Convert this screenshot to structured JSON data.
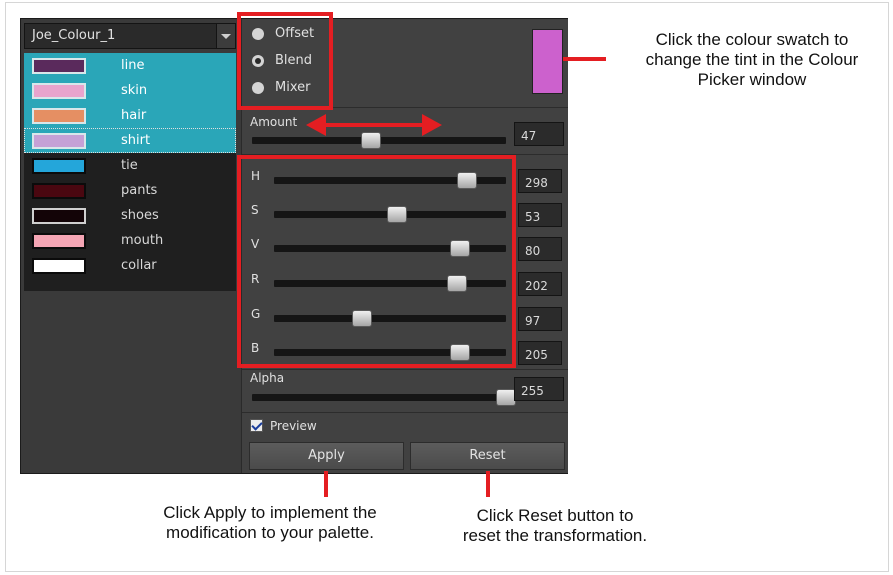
{
  "palette": {
    "name": "Joe_Colour_1",
    "colours": [
      {
        "name": "line",
        "hex": "#5a2a5c",
        "selected": true
      },
      {
        "name": "skin",
        "hex": "#e8a4cd",
        "selected": true
      },
      {
        "name": "hair",
        "hex": "#e58f63",
        "selected": true
      },
      {
        "name": "shirt",
        "hex": "#c5a1d6",
        "selected": true
      },
      {
        "name": "tie",
        "hex": "#24a6da",
        "selected": false
      },
      {
        "name": "pants",
        "hex": "#4a0710",
        "selected": false
      },
      {
        "name": "shoes",
        "hex": "#130407",
        "selected": false
      },
      {
        "name": "mouth",
        "hex": "#f4a5b4",
        "selected": false
      },
      {
        "name": "collar",
        "hex": "#ffffff",
        "selected": false
      }
    ]
  },
  "modes": {
    "offset_label": "Offset",
    "blend_label": "Blend",
    "mixer_label": "Mixer",
    "selected": "Blend"
  },
  "tint_swatch_color": "#cc61cd",
  "amount": {
    "label": "Amount",
    "value": "47",
    "fraction": 0.47
  },
  "sliders": [
    {
      "label": "H",
      "value": "298",
      "fraction": 0.83
    },
    {
      "label": "S",
      "value": "53",
      "fraction": 0.53
    },
    {
      "label": "V",
      "value": "80",
      "fraction": 0.8
    },
    {
      "label": "R",
      "value": "202",
      "fraction": 0.79
    },
    {
      "label": "G",
      "value": "97",
      "fraction": 0.38
    },
    {
      "label": "B",
      "value": "205",
      "fraction": 0.8
    }
  ],
  "alpha": {
    "label": "Alpha",
    "value": "255",
    "fraction": 1.0
  },
  "preview": {
    "label": "Preview",
    "checked": true
  },
  "buttons": {
    "apply": "Apply",
    "reset": "Reset"
  },
  "annotations": {
    "swatch_line1": "Click the colour swatch to",
    "swatch_line2": "change the tint in the Colour",
    "swatch_line3": "Picker window",
    "apply_line1": "Click Apply to implement the",
    "apply_line2": "modification to your palette.",
    "reset_line1": "Click Reset button to",
    "reset_line2": "reset the transformation."
  },
  "highlight_color": "#e41e22"
}
